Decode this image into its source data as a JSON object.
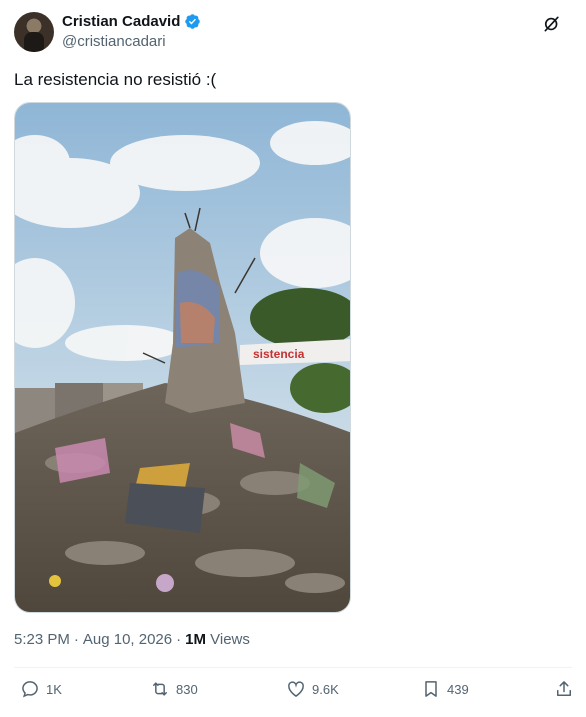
{
  "author": {
    "display_name": "Cristian Cadavid",
    "handle": "@cristiancadari",
    "verified": true
  },
  "tweet": {
    "text": "La resistencia no resistió :(",
    "photo_graffiti_text": "sistencia"
  },
  "meta": {
    "time": "5:23 PM",
    "separator": "·",
    "date": "Aug 10, 2026",
    "views_count": "1M",
    "views_label": "Views"
  },
  "actions": {
    "replies": "1K",
    "reposts": "830",
    "likes": "9.6K",
    "bookmarks": "439"
  },
  "colors": {
    "verified_blue": "#1d9bf0",
    "text_primary": "#0f1419",
    "text_secondary": "#536471"
  },
  "icons": [
    "grok-icon",
    "verified-badge-icon",
    "reply-icon",
    "repost-icon",
    "like-icon",
    "bookmark-icon",
    "share-icon"
  ]
}
